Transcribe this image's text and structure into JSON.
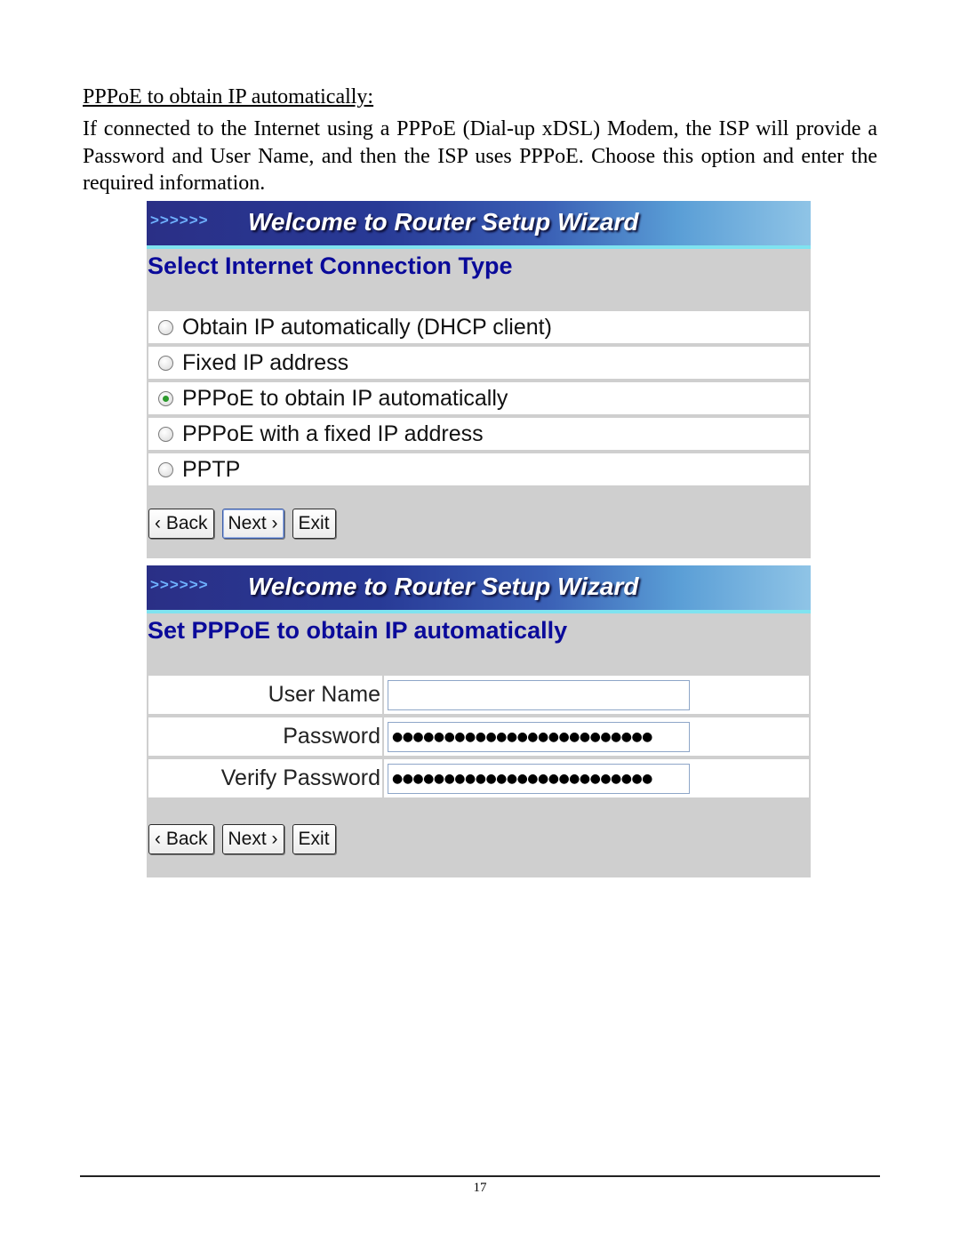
{
  "document": {
    "heading": "PPPoE to obtain IP automatically:",
    "paragraph": "If connected to the Internet using a PPPoE (Dial-up xDSL) Modem, the ISP will provide a Password and User Name, and then the ISP uses PPPoE. Choose this option and enter the required information.",
    "page_number": "17"
  },
  "wizard1": {
    "banner_arrows": ">>>>>>",
    "banner_title": "Welcome to Router Setup Wizard",
    "subtitle": "Select Internet Connection Type",
    "options": [
      {
        "label": "Obtain IP automatically (DHCP client)",
        "checked": false
      },
      {
        "label": "Fixed IP address",
        "checked": false
      },
      {
        "label": "PPPoE to obtain IP automatically",
        "checked": true
      },
      {
        "label": "PPPoE with a fixed IP address",
        "checked": false
      },
      {
        "label": "PPTP",
        "checked": false
      }
    ],
    "buttons": {
      "back": "‹ Back",
      "next": "Next ›",
      "exit": "Exit"
    }
  },
  "wizard2": {
    "banner_arrows": ">>>>>>",
    "banner_title": "Welcome to Router Setup Wizard",
    "subtitle": "Set PPPoE to obtain IP automatically",
    "fields": [
      {
        "label": "User Name",
        "value": "",
        "type": "text"
      },
      {
        "label": "Password",
        "value": "●●●●●●●●●●●●●●●●●●●●●●●●●",
        "type": "password"
      },
      {
        "label": "Verify Password",
        "value": "●●●●●●●●●●●●●●●●●●●●●●●●●",
        "type": "password"
      }
    ],
    "buttons": {
      "back": "‹ Back",
      "next": "Next ›",
      "exit": "Exit"
    }
  }
}
